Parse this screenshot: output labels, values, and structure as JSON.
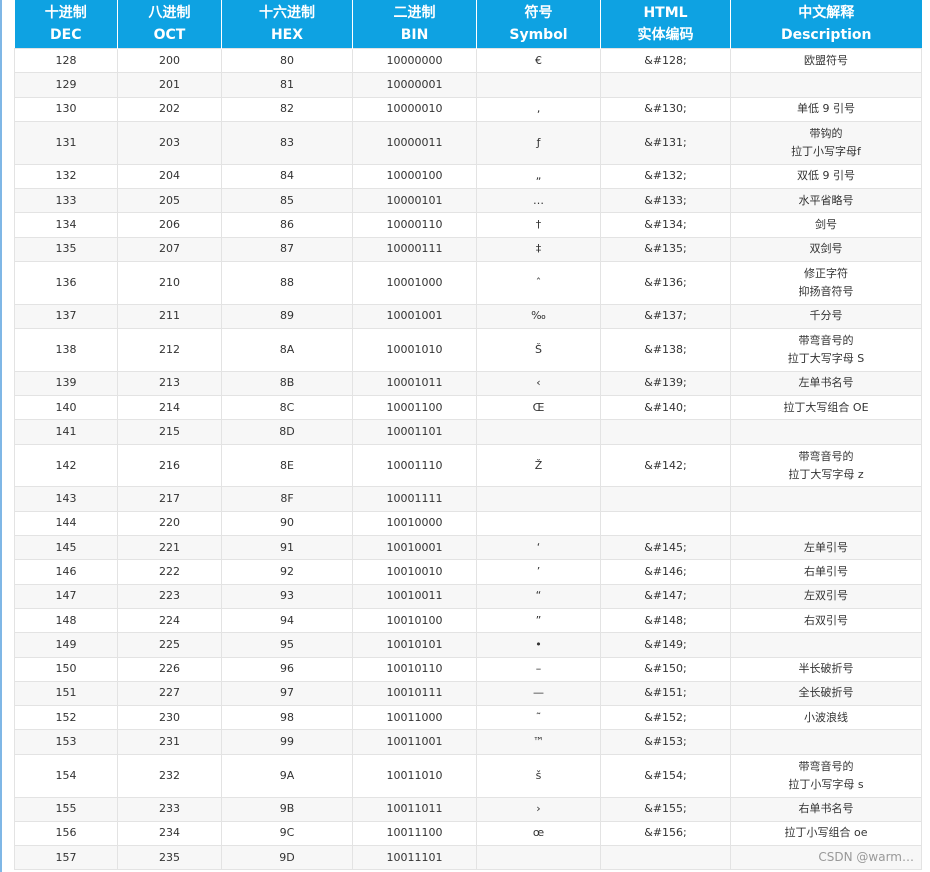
{
  "headers": [
    {
      "cn": "十进制",
      "en": "DEC"
    },
    {
      "cn": "八进制",
      "en": "OCT"
    },
    {
      "cn": "十六进制",
      "en": "HEX"
    },
    {
      "cn": "二进制",
      "en": "BIN"
    },
    {
      "cn": "符号",
      "en": "Symbol"
    },
    {
      "cn": "HTML",
      "en": "实体编码"
    },
    {
      "cn": "中文解释",
      "en": "Description"
    }
  ],
  "rows": [
    {
      "dec": "128",
      "oct": "200",
      "hex": "80",
      "bin": "10000000",
      "sym": "€",
      "html": "&#128;",
      "desc": [
        "欧盟符号"
      ]
    },
    {
      "dec": "129",
      "oct": "201",
      "hex": "81",
      "bin": "10000001",
      "sym": "",
      "html": "",
      "desc": []
    },
    {
      "dec": "130",
      "oct": "202",
      "hex": "82",
      "bin": "10000010",
      "sym": "‚",
      "html": "&#130;",
      "desc": [
        "单低 9 引号"
      ]
    },
    {
      "dec": "131",
      "oct": "203",
      "hex": "83",
      "bin": "10000011",
      "sym": "ƒ",
      "html": "&#131;",
      "desc": [
        "带钩的",
        "拉丁小写字母f"
      ]
    },
    {
      "dec": "132",
      "oct": "204",
      "hex": "84",
      "bin": "10000100",
      "sym": "„",
      "html": "&#132;",
      "desc": [
        "双低 9 引号"
      ]
    },
    {
      "dec": "133",
      "oct": "205",
      "hex": "85",
      "bin": "10000101",
      "sym": "…",
      "html": "&#133;",
      "desc": [
        "水平省略号"
      ]
    },
    {
      "dec": "134",
      "oct": "206",
      "hex": "86",
      "bin": "10000110",
      "sym": "†",
      "html": "&#134;",
      "desc": [
        "剑号"
      ]
    },
    {
      "dec": "135",
      "oct": "207",
      "hex": "87",
      "bin": "10000111",
      "sym": "‡",
      "html": "&#135;",
      "desc": [
        "双剑号"
      ]
    },
    {
      "dec": "136",
      "oct": "210",
      "hex": "88",
      "bin": "10001000",
      "sym": "ˆ",
      "html": "&#136;",
      "desc": [
        "修正字符",
        "抑扬音符号"
      ]
    },
    {
      "dec": "137",
      "oct": "211",
      "hex": "89",
      "bin": "10001001",
      "sym": "‰",
      "html": "&#137;",
      "desc": [
        "千分号"
      ]
    },
    {
      "dec": "138",
      "oct": "212",
      "hex": "8A",
      "bin": "10001010",
      "sym": "Š",
      "html": "&#138;",
      "desc": [
        "带弯音号的",
        "拉丁大写字母 S"
      ]
    },
    {
      "dec": "139",
      "oct": "213",
      "hex": "8B",
      "bin": "10001011",
      "sym": "‹",
      "html": "&#139;",
      "desc": [
        "左单书名号"
      ]
    },
    {
      "dec": "140",
      "oct": "214",
      "hex": "8C",
      "bin": "10001100",
      "sym": "Œ",
      "html": "&#140;",
      "desc": [
        "拉丁大写组合 OE"
      ]
    },
    {
      "dec": "141",
      "oct": "215",
      "hex": "8D",
      "bin": "10001101",
      "sym": "",
      "html": "",
      "desc": []
    },
    {
      "dec": "142",
      "oct": "216",
      "hex": "8E",
      "bin": "10001110",
      "sym": "Ž",
      "html": "&#142;",
      "desc": [
        "带弯音号的",
        "拉丁大写字母 z"
      ]
    },
    {
      "dec": "143",
      "oct": "217",
      "hex": "8F",
      "bin": "10001111",
      "sym": "",
      "html": "",
      "desc": []
    },
    {
      "dec": "144",
      "oct": "220",
      "hex": "90",
      "bin": "10010000",
      "sym": "",
      "html": "",
      "desc": []
    },
    {
      "dec": "145",
      "oct": "221",
      "hex": "91",
      "bin": "10010001",
      "sym": "‘",
      "html": "&#145;",
      "desc": [
        "左单引号"
      ]
    },
    {
      "dec": "146",
      "oct": "222",
      "hex": "92",
      "bin": "10010010",
      "sym": "’",
      "html": "&#146;",
      "desc": [
        "右单引号"
      ]
    },
    {
      "dec": "147",
      "oct": "223",
      "hex": "93",
      "bin": "10010011",
      "sym": "“",
      "html": "&#147;",
      "desc": [
        "左双引号"
      ]
    },
    {
      "dec": "148",
      "oct": "224",
      "hex": "94",
      "bin": "10010100",
      "sym": "”",
      "html": "&#148;",
      "desc": [
        "右双引号"
      ]
    },
    {
      "dec": "149",
      "oct": "225",
      "hex": "95",
      "bin": "10010101",
      "sym": "•",
      "html": "&#149;",
      "desc": []
    },
    {
      "dec": "150",
      "oct": "226",
      "hex": "96",
      "bin": "10010110",
      "sym": "–",
      "html": "&#150;",
      "desc": [
        "半长破折号"
      ]
    },
    {
      "dec": "151",
      "oct": "227",
      "hex": "97",
      "bin": "10010111",
      "sym": "—",
      "html": "&#151;",
      "desc": [
        "全长破折号"
      ]
    },
    {
      "dec": "152",
      "oct": "230",
      "hex": "98",
      "bin": "10011000",
      "sym": "˜",
      "html": "&#152;",
      "desc": [
        "小波浪线"
      ]
    },
    {
      "dec": "153",
      "oct": "231",
      "hex": "99",
      "bin": "10011001",
      "sym": "™",
      "html": "&#153;",
      "desc": []
    },
    {
      "dec": "154",
      "oct": "232",
      "hex": "9A",
      "bin": "10011010",
      "sym": "š",
      "html": "&#154;",
      "desc": [
        "带弯音号的",
        "拉丁小写字母 s"
      ]
    },
    {
      "dec": "155",
      "oct": "233",
      "hex": "9B",
      "bin": "10011011",
      "sym": "›",
      "html": "&#155;",
      "desc": [
        "右单书名号"
      ]
    },
    {
      "dec": "156",
      "oct": "234",
      "hex": "9C",
      "bin": "10011100",
      "sym": "œ",
      "html": "&#156;",
      "desc": [
        "拉丁小写组合 oe"
      ]
    },
    {
      "dec": "157",
      "oct": "235",
      "hex": "9D",
      "bin": "10011101",
      "sym": "",
      "html": "",
      "desc": []
    }
  ],
  "watermark": "CSDN @warm…",
  "colors": {
    "header_bg": "#0ea2e2",
    "header_text": "#ffffff",
    "stripe": "#f7f7f7",
    "border": "#e3e3e3"
  }
}
